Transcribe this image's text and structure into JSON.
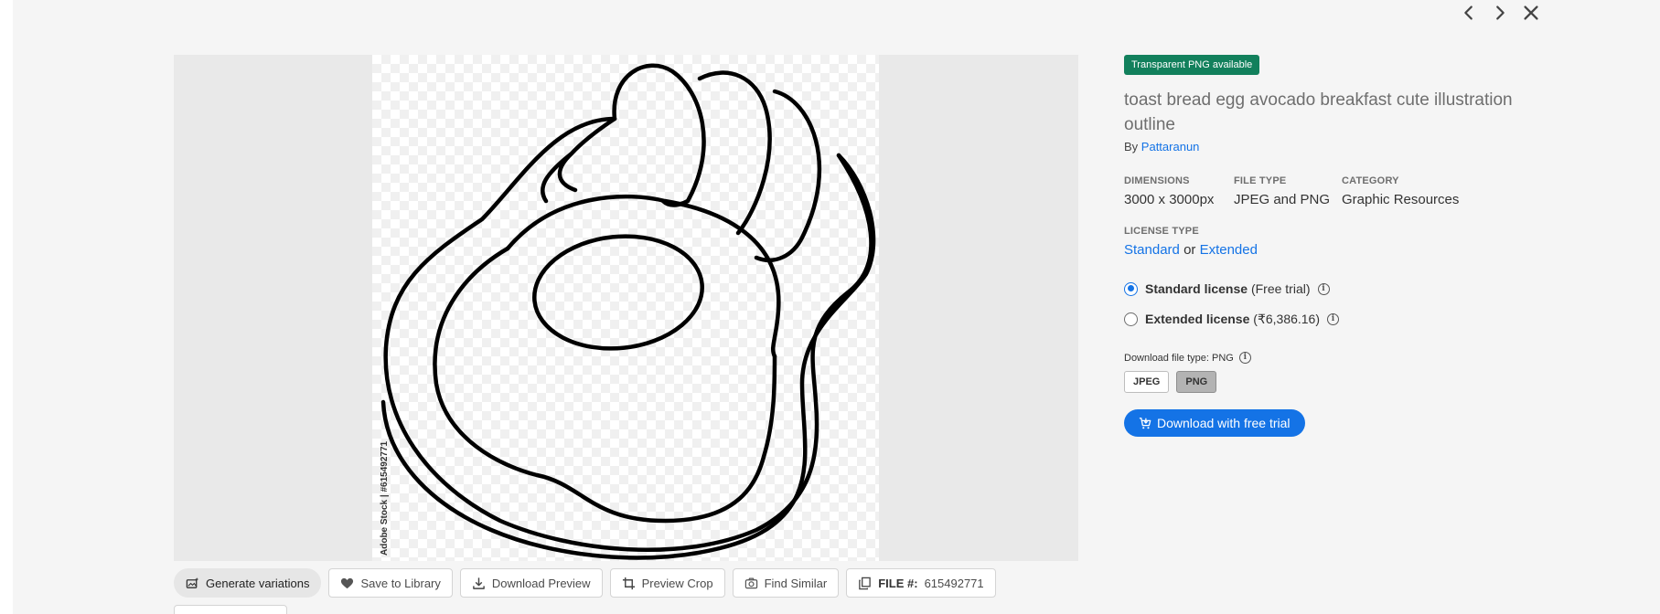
{
  "nav": {
    "prev_icon": "chevron-left-icon",
    "next_icon": "chevron-right-icon",
    "close_icon": "close-icon"
  },
  "preview": {
    "watermark": "Adobe Stock | #615492771"
  },
  "actions": {
    "generate": "Generate variations",
    "save": "Save to Library",
    "download_preview": "Download Preview",
    "preview_crop": "Preview Crop",
    "find_similar": "Find Similar",
    "file_label": "FILE #:",
    "file_number": "615492771"
  },
  "info": {
    "badge": "Transparent PNG available",
    "title": "toast bread egg avocado breakfast cute illustration outline",
    "by_prefix": "By",
    "author": "Pattaranun",
    "dimensions_label": "DIMENSIONS",
    "dimensions_value": "3000 x 3000px",
    "filetype_label": "FILE TYPE",
    "filetype_value": "JPEG and PNG",
    "category_label": "CATEGORY",
    "category_value": "Graphic Resources",
    "license_type_label": "LICENSE TYPE",
    "license_standard": "Standard",
    "license_or": "or",
    "license_extended": "Extended",
    "standard_license_label": "Standard license",
    "standard_license_note": "(Free trial)",
    "extended_license_label": "Extended license",
    "extended_license_note": "(₹6,386.16)",
    "download_file_type": "Download file type: PNG",
    "jpeg": "JPEG",
    "png": "PNG",
    "download_button": "Download with free trial"
  },
  "colors": {
    "accent": "#1473e6",
    "badge": "#12805c"
  }
}
